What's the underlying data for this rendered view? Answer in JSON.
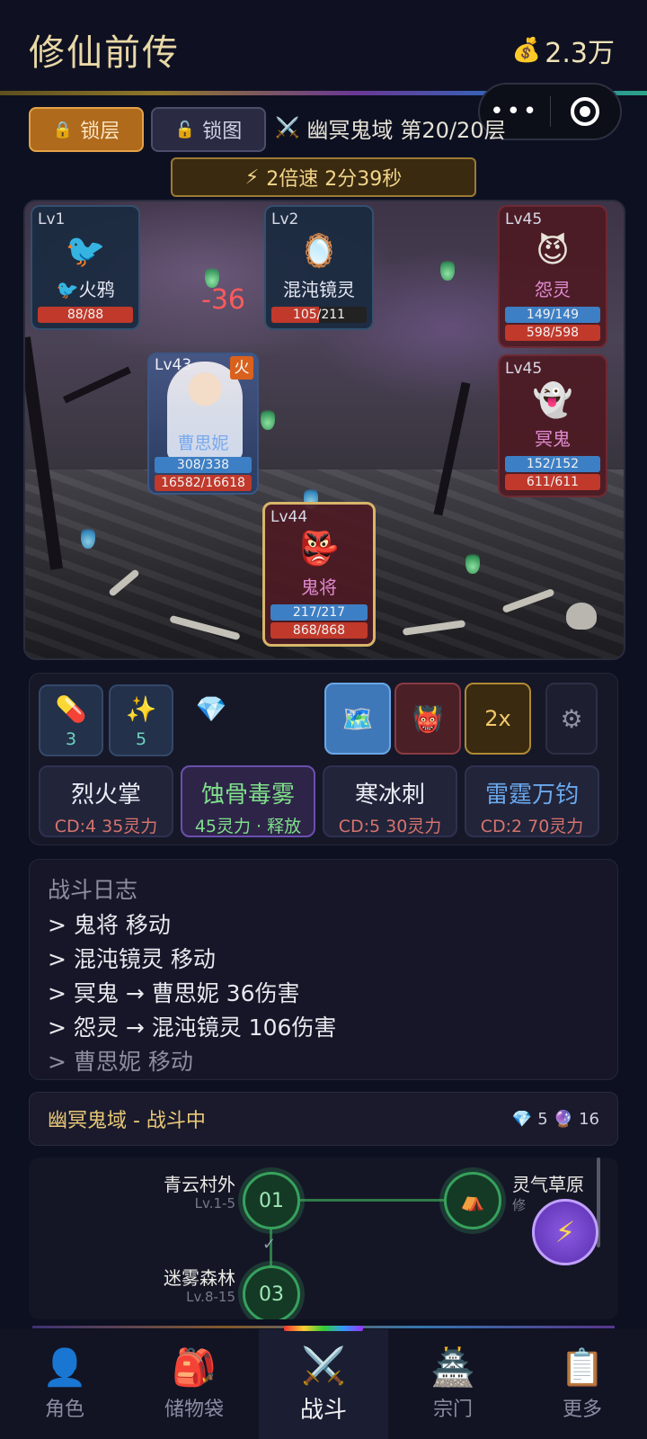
{
  "header": {
    "title": "修仙前传",
    "currency": "2.3万",
    "currency_icon": "money-bag-icon",
    "capsule_more": "•••"
  },
  "toolbar": {
    "lock_layer_label": "锁层",
    "lock_map_label": "锁图",
    "stage_name": "幽冥鬼域",
    "stage_floor": "第20/20层",
    "speed_text": "2倍速 2分39秒"
  },
  "battle": {
    "damage_float": "-36",
    "units": {
      "crow": {
        "level": "Lv1",
        "name": "🐦火鸦",
        "icon": "🐦",
        "hp": "88/88"
      },
      "mirror": {
        "level": "Lv2",
        "name": "混沌镜灵",
        "icon": "🪞",
        "hp": "105/211"
      },
      "wraith": {
        "level": "Lv45",
        "name": "怨灵",
        "icon": "😈",
        "mp": "149/149",
        "hp": "598/598"
      },
      "hero": {
        "level": "Lv43",
        "element": "火",
        "name": "曹思妮",
        "mp": "308/338",
        "hp": "16582/16618"
      },
      "ghost": {
        "level": "Lv45",
        "name": "冥鬼",
        "icon": "👻",
        "mp": "152/152",
        "hp": "611/611"
      },
      "general": {
        "level": "Lv44",
        "name": "鬼将",
        "icon": "👺",
        "mp": "217/217",
        "hp": "868/868"
      }
    }
  },
  "controls": {
    "items": [
      {
        "icon": "💊",
        "count": "3"
      },
      {
        "icon": "✨",
        "count": "5"
      },
      {
        "icon": "💎",
        "count": ""
      }
    ],
    "tools": {
      "map_icon": "🗺️",
      "demon_icon": "👹",
      "speed_label": "2x",
      "gear_icon": "⚙"
    },
    "skills": [
      {
        "name": "烈火掌",
        "info": "CD:4  35灵力"
      },
      {
        "name": "蚀骨毒雾",
        "info": "45灵力 · 释放"
      },
      {
        "name": "寒冰刺",
        "info": "CD:5  30灵力"
      },
      {
        "name": "雷霆万钧",
        "info": "CD:2  70灵力"
      }
    ]
  },
  "log": {
    "title": "战斗日志",
    "lines": [
      "> 鬼将 移动",
      "> 混沌镜灵 移动",
      "> 冥鬼 → 曹思妮 36伤害",
      "> 怨灵 → 混沌镜灵 106伤害",
      "> 曹思妮 移动"
    ]
  },
  "status": {
    "text": "幽冥鬼域 - 战斗中",
    "gems": "5",
    "orbs": "16"
  },
  "map": {
    "nodes": [
      {
        "name": "青云村外",
        "range": "Lv.1-5",
        "number": "01"
      },
      {
        "name": "迷雾森林",
        "range": "Lv.8-15",
        "number": "03"
      },
      {
        "name": "灵气草原",
        "range": "修",
        "icon": "⛺"
      }
    ]
  },
  "tabs": [
    {
      "label": "角色",
      "icon": "👤"
    },
    {
      "label": "储物袋",
      "icon": "🎒"
    },
    {
      "label": "战斗",
      "icon": "⚔️"
    },
    {
      "label": "宗门",
      "icon": "🏯"
    },
    {
      "label": "更多",
      "icon": "📋"
    }
  ],
  "colors": {
    "accent_gold": "#e9c978",
    "lock_active": "#b06a1c",
    "hp_red": "#c0392b",
    "mp_blue": "#3d7fc4",
    "map_green": "#36a25c"
  }
}
